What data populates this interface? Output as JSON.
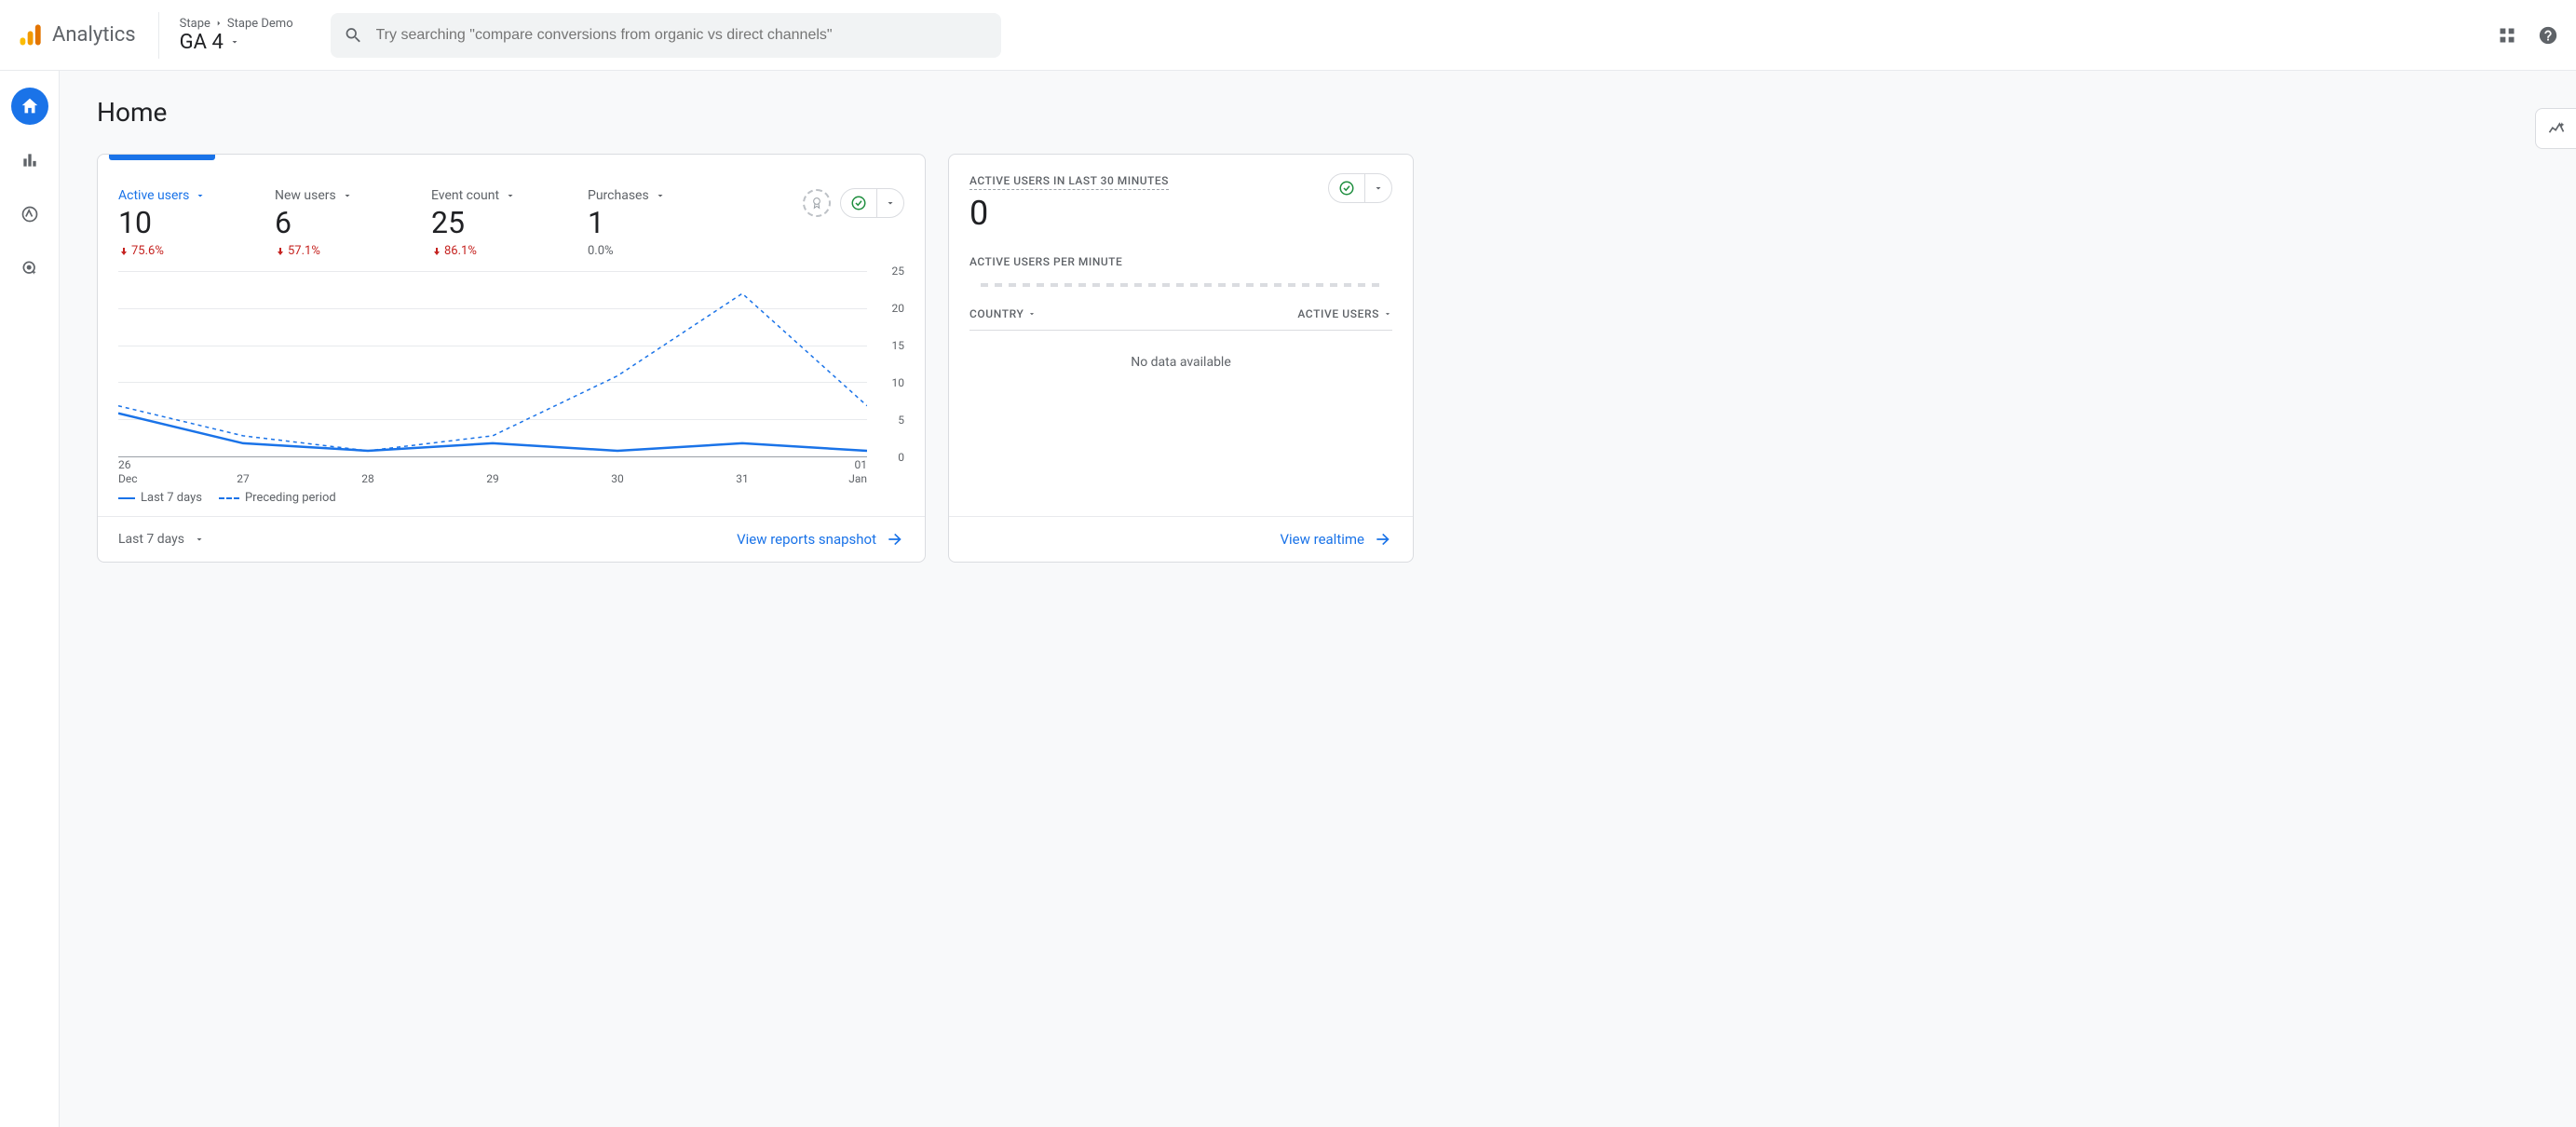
{
  "header": {
    "product": "Analytics",
    "breadcrumb": [
      "Stape",
      "Stape Demo"
    ],
    "property": "GA 4",
    "search_placeholder": "Try searching \"compare conversions from organic vs direct channels\""
  },
  "page": {
    "title": "Home"
  },
  "overview": {
    "metrics": [
      {
        "label": "Active users",
        "value": "10",
        "delta": "75.6%",
        "direction": "down",
        "active": true
      },
      {
        "label": "New users",
        "value": "6",
        "delta": "57.1%",
        "direction": "down"
      },
      {
        "label": "Event count",
        "value": "25",
        "delta": "86.1%",
        "direction": "down"
      },
      {
        "label": "Purchases",
        "value": "1",
        "delta": "0.0%",
        "direction": "neutral"
      }
    ],
    "legend": {
      "current": "Last 7 days",
      "previous": "Preceding period"
    },
    "date_range": "Last 7 days",
    "link": "View reports snapshot"
  },
  "realtime": {
    "title": "ACTIVE USERS IN LAST 30 MINUTES",
    "value": "0",
    "per_minute_label": "ACTIVE USERS PER MINUTE",
    "col_country": "COUNTRY",
    "col_users": "ACTIVE USERS",
    "no_data": "No data available",
    "link": "View realtime"
  },
  "chart_data": {
    "type": "line",
    "x": [
      "26 Dec",
      "27",
      "28",
      "29",
      "30",
      "31",
      "01 Jan"
    ],
    "xtick_top": [
      "26",
      "27",
      "28",
      "29",
      "30",
      "31",
      "01"
    ],
    "xtick_bot": [
      "Dec",
      "",
      "",
      "",
      "",
      "",
      "Jan"
    ],
    "ylim": [
      0,
      25
    ],
    "yticks": [
      0,
      5,
      10,
      15,
      20,
      25
    ],
    "series": [
      {
        "name": "Last 7 days",
        "style": "solid",
        "values": [
          6,
          2,
          1,
          2,
          1,
          2,
          1
        ]
      },
      {
        "name": "Preceding period",
        "style": "dashed",
        "values": [
          7,
          3,
          1,
          3,
          11,
          22,
          7
        ]
      }
    ]
  }
}
